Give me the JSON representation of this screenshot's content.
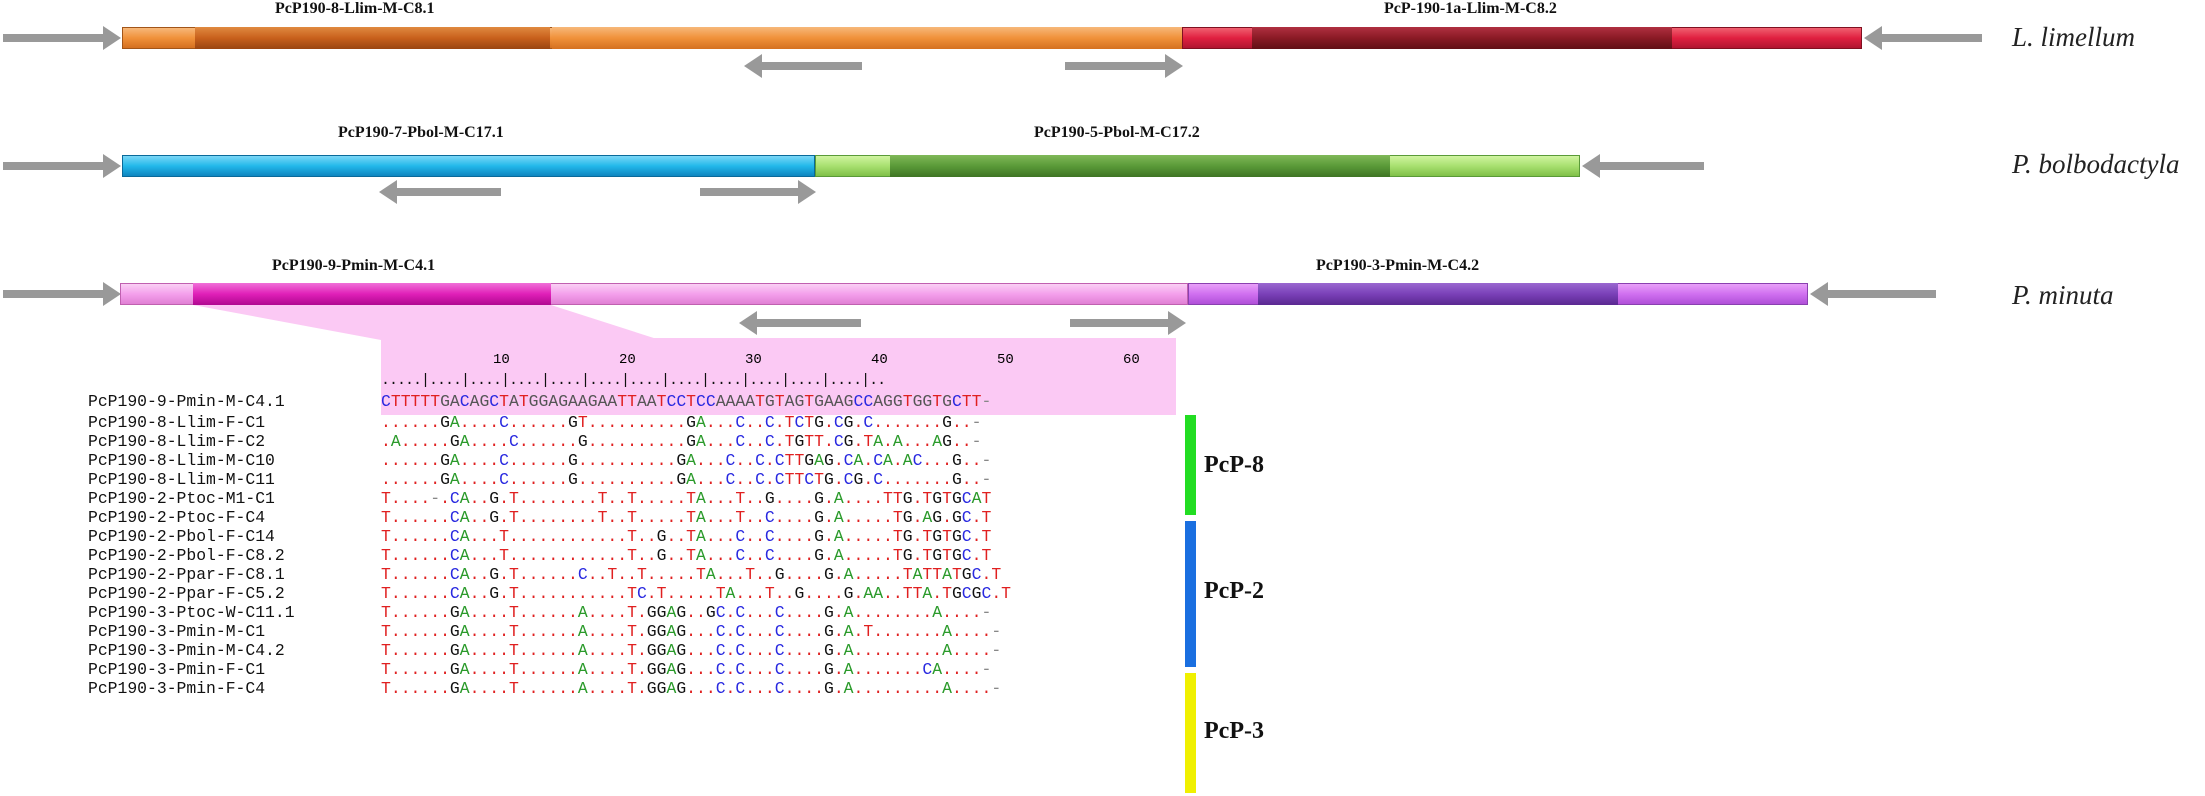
{
  "rows": [
    {
      "species": "L. limellum",
      "segments": [
        {
          "label": "PcP190-8-Llim-M-C8.1",
          "color": "#f0913a",
          "core_color": "#c8601c"
        },
        {
          "label": "PcP-190-1a-Llim-M-C8.2",
          "color": "#e02040",
          "core_color": "#8a1a25"
        }
      ]
    },
    {
      "species": "P. bolbodactyla",
      "segments": [
        {
          "label": "PcP190-7-Pbol-M-C17.1",
          "color": "#22b8ea",
          "core_color": "#0e86c0"
        },
        {
          "label": "PcP190-5-Pbol-M-C17.2",
          "color": "#a8e070",
          "core_color": "#5a9a38"
        }
      ]
    },
    {
      "species": "P. minuta",
      "segments": [
        {
          "label": "PcP190-9-Pmin-M-C4.1",
          "color": "#f4a0ec",
          "core_color": "#e020b8"
        },
        {
          "label": "PcP190-3-Pmin-M-C4.2",
          "color": "#d070f0",
          "core_color": "#7a40b8"
        }
      ]
    }
  ],
  "alignment": {
    "ruler_numbers": [
      "10",
      "20",
      "30",
      "40",
      "50",
      "60"
    ],
    "ruler_ticks": ".....|....|....|....|....|....|....|....|....|....|....|....|..",
    "reference": {
      "name": "PcP190-9-Pmin-M-C4.1",
      "seq": "CTTTTTGACAGCTATGGAGAAGAATTAATCCTCCAAAATGTAGTGAAGCCAGGTGGTGCTT-"
    },
    "sequences": [
      {
        "name": "PcP190-8-Llim-F-C1",
        "seq": "......GA....C......GT..........GA...C..C.TCTG.CG.C.......G..-"
      },
      {
        "name": "PcP190-8-Llim-F-C2",
        "seq": ".A.....GA....C......G..........GA...C..C.TGTT.CG.TA.A...AG..-"
      },
      {
        "name": "PcP190-8-Llim-M-C10",
        "seq": "......GA....C......G..........GA...C..C.CTTGAG.CA.CA.AC...G..-"
      },
      {
        "name": "PcP190-8-Llim-M-C11",
        "seq": "......GA....C......G..........GA...C..C.CTTCTG.CG.C.......G..-"
      },
      {
        "name": "PcP190-2-Ptoc-M1-C1",
        "seq": "T....-.CA..G.T........T..T.....TA...T..G....G.A....TTG.TGTGCAT"
      },
      {
        "name": "PcP190-2-Ptoc-F-C4",
        "seq": "T......CA..G.T........T..T.....TA...T..C....G.A.....TG.AG.GC.T"
      },
      {
        "name": "PcP190-2-Pbol-F-C14",
        "seq": "T......CA...T............T..G..TA...C..C....G.A.....TG.TGTGC.T"
      },
      {
        "name": "PcP190-2-Pbol-F-C8.2",
        "seq": "T......CA...T............T..G..TA...C..C....G.A.....TG.TGTGC.T"
      },
      {
        "name": "PcP190-2-Ppar-F-C8.1",
        "seq": "T......CA..G.T......C..T..T.....TA...T..G....G.A.....TATTATGC.T"
      },
      {
        "name": "PcP190-2-Ppar-F-C5.2",
        "seq": "T......CA..G.T...........TC.T.....TA...T..G....G.AA..TTA.TGCGC.T"
      },
      {
        "name": "PcP190-3-Ptoc-W-C11.1",
        "seq": "T......GA....T......A....T.GGAG..GC.C...C....G.A........A....-"
      },
      {
        "name": "PcP190-3-Pmin-M-C1",
        "seq": "T......GA....T......A....T.GGAG...C.C...C....G.A.T.......A....-"
      },
      {
        "name": "PcP190-3-Pmin-M-C4.2",
        "seq": "T......GA....T......A....T.GGAG...C.C...C....G.A.........A....-"
      },
      {
        "name": "PcP190-3-Pmin-F-C1",
        "seq": "T......GA....T......A....T.GGAG...C.C...C....G.A.......CA....-"
      },
      {
        "name": "PcP190-3-Pmin-F-C4",
        "seq": "T......GA....T......A....T.GGAG...C.C...C....G.A.........A....-"
      }
    ],
    "groups": [
      {
        "label": "PcP-8",
        "color": "#22dd22"
      },
      {
        "label": "PcP-2",
        "color": "#1a6fe0"
      },
      {
        "label": "PcP-3",
        "color": "#f0f000"
      }
    ]
  }
}
